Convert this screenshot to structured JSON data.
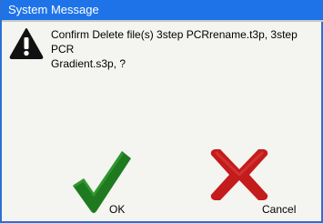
{
  "dialog": {
    "title": "System Message",
    "icon": "warning-icon",
    "message_line1": "Confirm Delete file(s) 3step PCRrename.t3p, 3step PCR",
    "message_line2": "Gradient.s3p,  ?"
  },
  "buttons": {
    "ok_label": "OK",
    "ok_icon": "checkmark-icon",
    "ok_color": "#1f7a1f",
    "cancel_label": "Cancel",
    "cancel_icon": "x-cross-icon",
    "cancel_color": "#c41b1b"
  },
  "colors": {
    "titlebar": "#1e73e8",
    "title_text": "#ffffff",
    "background": "#f4f4f0"
  }
}
